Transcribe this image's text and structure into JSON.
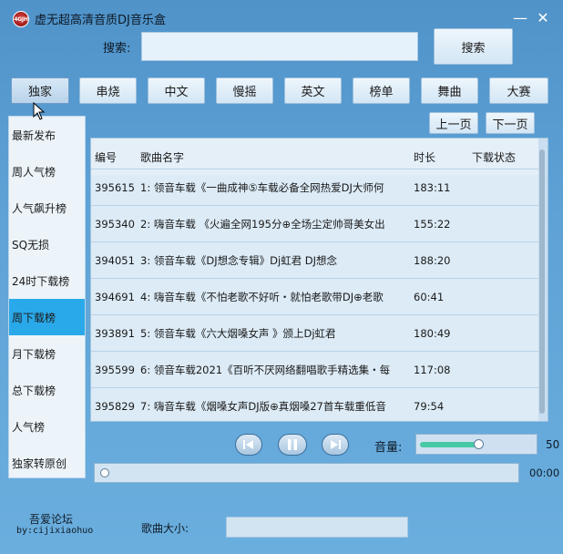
{
  "window": {
    "title": "虚无超高清音质DJ音乐盒",
    "logo_text": "4GJH",
    "minimize_glyph": "—",
    "close_glyph": "✕"
  },
  "search": {
    "label": "搜索:",
    "value": "",
    "placeholder": "",
    "button_label": "搜索"
  },
  "categories": [
    {
      "label": "独家",
      "active": true
    },
    {
      "label": "串烧"
    },
    {
      "label": "中文"
    },
    {
      "label": "慢摇"
    },
    {
      "label": "英文"
    },
    {
      "label": "榜单"
    },
    {
      "label": "舞曲"
    },
    {
      "label": "大赛"
    }
  ],
  "pager": {
    "prev_label": "上一页",
    "next_label": "下一页"
  },
  "sidebar": {
    "items": [
      {
        "label": "最新发布"
      },
      {
        "label": "周人气榜"
      },
      {
        "label": "人气飙升榜"
      },
      {
        "label": "SQ无损"
      },
      {
        "label": "24时下载榜"
      },
      {
        "label": "周下载榜",
        "selected": true
      },
      {
        "label": "月下载榜"
      },
      {
        "label": "总下载榜"
      },
      {
        "label": "人气榜"
      },
      {
        "label": "独家转原创"
      }
    ]
  },
  "table": {
    "headers": [
      "编号",
      "歌曲名字",
      "时长",
      "下载状态"
    ],
    "rows": [
      {
        "id": "395615",
        "name": "1: 领音车载《一曲成神⑤车载必备全网热爱DJ大师何",
        "duration": "183:11",
        "status": ""
      },
      {
        "id": "395340",
        "name": "2: 嗨音车载  《火遍全网195分⊕全场尘定帅哥美女出",
        "duration": "155:22",
        "status": ""
      },
      {
        "id": "394051",
        "name": "3: 领音车载《DJ想念专辑》Dj虹君 DJ想念",
        "duration": "188:20",
        "status": ""
      },
      {
        "id": "394691",
        "name": "4: 嗨音车载《不怕老歌不好听・就怕老歌带DJ⊕老歌",
        "duration": "60:41",
        "status": ""
      },
      {
        "id": "393891",
        "name": "5: 领音车载《六大烟嗓女声  》颁上Dj虹君",
        "duration": "180:49",
        "status": ""
      },
      {
        "id": "395599",
        "name": "6: 领音车载2021《百听不厌网络翻唱歌手精选集・每",
        "duration": "117:08",
        "status": ""
      },
      {
        "id": "395829",
        "name": "7: 嗨音车载《烟嗓女声DJ版⊕真烟嗓27首车载重低音",
        "duration": "79:54",
        "status": ""
      }
    ]
  },
  "player": {
    "volume_label": "音量:",
    "volume_value": "50",
    "volume_fraction": 0.5,
    "time": "00:00",
    "progress_fraction": 0.0
  },
  "footer": {
    "brand_line1": "吾爱论坛",
    "brand_line2": "by:cijixiaohuo",
    "size_label": "歌曲大小:",
    "size_value": ""
  },
  "colors": {
    "selected": "#2aa9ea",
    "volume_fill": "#48c9a6"
  }
}
